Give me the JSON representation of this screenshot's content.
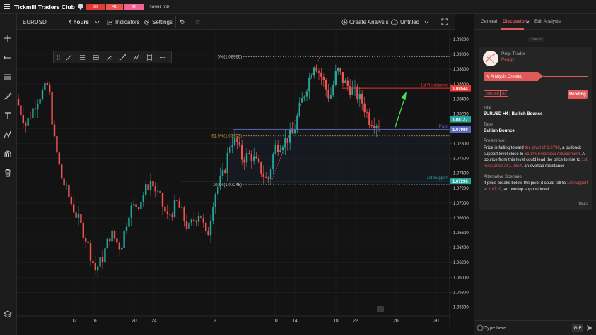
{
  "app": {
    "title": "Tickmill Traders Club",
    "xp_bars": [
      "90",
      "41",
      "42"
    ],
    "xp": "30991 XP"
  },
  "header": {
    "symbol": "EURUSD",
    "interval": "4 hours",
    "indicators": "Indicators",
    "settings": "Settings",
    "create_analysis": "Create Analysis",
    "layout_name": "Untitled"
  },
  "chart_data": {
    "type": "candlestick",
    "price_axis": [
      "1.09200",
      "1.09000",
      "1.08800",
      "1.08600",
      "1.08400",
      "1.08200",
      "1.08000",
      "1.07800",
      "1.07600",
      "1.07400",
      "1.07200",
      "1.07000",
      "1.06800",
      "1.06600",
      "1.06400",
      "1.06200",
      "1.06000",
      "1.05800",
      "1.05600"
    ],
    "time_axis": [
      "12",
      "16",
      "20",
      "24",
      "2",
      "10",
      "14",
      "18",
      "22",
      "26",
      "30"
    ],
    "ylim": [
      1.0555,
      1.0925
    ],
    "price_tags": [
      {
        "value": "1.08544",
        "color": "#e53935"
      },
      {
        "value": "1.08127",
        "color": "#26a69a"
      },
      {
        "value": "1.07989",
        "color": "#5c6bc0"
      },
      {
        "value": "1.07296",
        "color": "#26a69a"
      }
    ],
    "levels": [
      {
        "name": "1st Resistance",
        "price": 1.08544,
        "color": "#e53935"
      },
      {
        "name": "Pivot",
        "price": 1.07989,
        "color": "#5c6bc0"
      },
      {
        "name": "1st Support",
        "price": 1.07296,
        "color": "#26a69a"
      }
    ],
    "fib_labels": [
      {
        "text": "0%(1.08966)",
        "price": 1.08966
      },
      {
        "text": "61.8%(1.07903)",
        "price": 1.07903
      },
      {
        "text": "100%(1.07246)",
        "price": 1.07246
      }
    ]
  },
  "panel": {
    "tabs": [
      "General",
      "Discussion",
      "Edit Analysis"
    ],
    "today": "TODAY",
    "role": "Prop Trader",
    "name": "Peggy",
    "banner": "Analysis Created",
    "tags": [
      "EURUSD",
      "H4"
    ],
    "status": "Pending",
    "title_label": "Title",
    "title_value": "EURUSD H4 | Bullish Bounce",
    "type_label": "Type",
    "type_value": "Bullish Bounce",
    "pref_label": "Preference:",
    "pref_parts": [
      "Price is falling toward ",
      "the pivot of 1.0798",
      ", a pullback support level close to ",
      "61.8% Fibonacci retracement",
      ".  A bounce from this level could lead the price to rise to ",
      "1st resistance at 1.0854",
      ", an overlap resistance"
    ],
    "alt_label": "Alternative Scenario:",
    "alt_parts": [
      "If price breaks below the pivot it could fall to ",
      "1st support at 1.0729",
      ", an overlap support level"
    ],
    "time": "09:42",
    "input_placeholder": "Type here...",
    "gif": "GIF"
  }
}
